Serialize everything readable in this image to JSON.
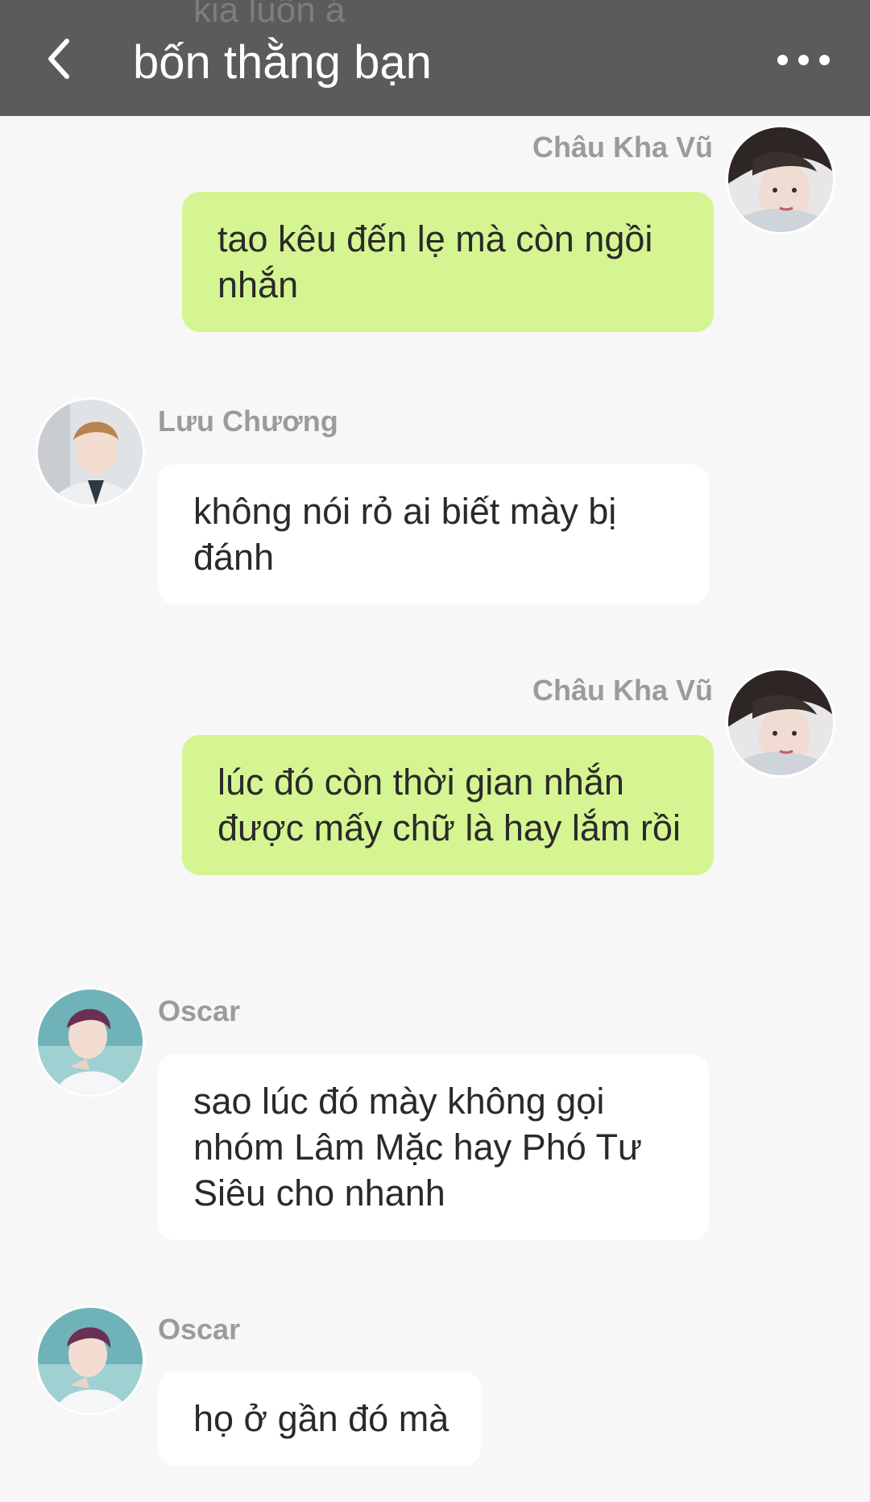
{
  "header": {
    "peek_text": "kia luôn á",
    "title": "bốn thằng bạn"
  },
  "messages": [
    {
      "sender": "Châu Kha Vũ",
      "text": "tao kêu đến lẹ mà còn ngồi nhắn"
    },
    {
      "sender": "Lưu Chương",
      "text": "không nói rỏ ai biết mày bị đánh"
    },
    {
      "sender": "Châu Kha Vũ",
      "text": "lúc đó còn thời gian nhắn được mấy chữ là hay lắm rồi"
    },
    {
      "sender": "Oscar",
      "text": "sao lúc đó mày không gọi nhóm Lâm Mặc hay Phó Tư Siêu cho nhanh"
    },
    {
      "sender": "Oscar",
      "text": "họ ở gần đó mà"
    }
  ]
}
